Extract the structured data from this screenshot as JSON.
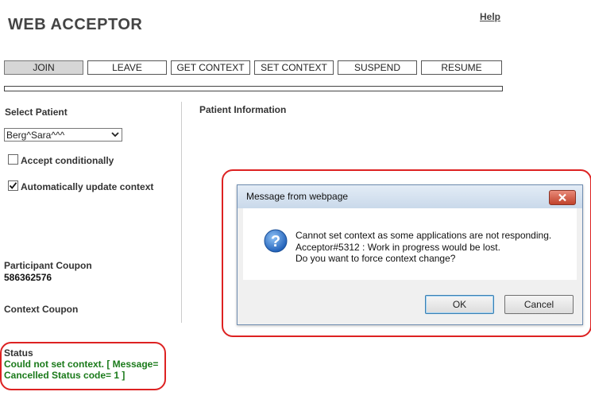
{
  "header": {
    "title": "WEB ACCEPTOR",
    "help": "Help"
  },
  "toolbar": [
    {
      "label": "JOIN",
      "active": true
    },
    {
      "label": "LEAVE"
    },
    {
      "label": "GET CONTEXT"
    },
    {
      "label": "SET CONTEXT"
    },
    {
      "label": "SUSPEND"
    },
    {
      "label": "RESUME"
    }
  ],
  "left": {
    "select_patient_label": "Select Patient",
    "patient_value": "Berg^Sara^^^",
    "accept_conditionally": {
      "label": "Accept conditionally",
      "checked": false
    },
    "auto_update": {
      "label": "Automatically update context",
      "checked": true
    },
    "participant_coupon_label": "Participant Coupon",
    "participant_coupon_value": "586362576",
    "context_coupon_label": "Context Coupon",
    "status_label": "Status",
    "status_lines": [
      "Could not set context. [ Message=",
      "Cancelled Status code= 1 ]"
    ]
  },
  "right": {
    "patient_info_label": "Patient Information"
  },
  "dialog": {
    "title": "Message from webpage",
    "message_lines": [
      "Cannot set context as some applications are not responding.",
      "Acceptor#5312 : Work in progress would be lost.",
      "Do you want to force context change?"
    ],
    "ok": "OK",
    "cancel": "Cancel",
    "icon": "question-icon"
  },
  "colors": {
    "status": "#1a7a1a",
    "highlight_ring": "#dd2222"
  }
}
